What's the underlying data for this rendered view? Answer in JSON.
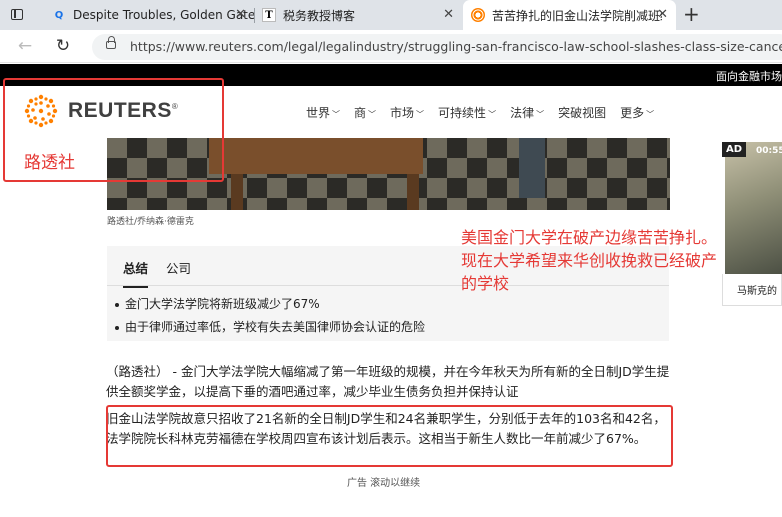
{
  "browser": {
    "tabs": [
      {
        "label": "Despite Troubles, Golden Gate U",
        "favicon": "search-icon"
      },
      {
        "label": "税务教授博客",
        "favicon": "taxprof-T-icon"
      },
      {
        "label": "苦苦挣扎的旧金山法学院削减班级",
        "favicon": "reuters-icon",
        "active": true
      }
    ],
    "url": "https://www.reuters.com/legal/legalindustry/struggling-san-francisco-law-school-slashes-class-size-cancels-tuition-2..."
  },
  "site": {
    "top_bar_text": "面向金融市场",
    "logo_word": "REUTERS",
    "logo_mark": "®",
    "nav": [
      "世界",
      "商",
      "市场",
      "可持续性",
      "法律",
      "突破视图",
      "更多"
    ]
  },
  "article": {
    "photo_caption": "路透社/乔纳森·德雷克",
    "summary_tabs": [
      "总结",
      "公司"
    ],
    "summary_bullets": [
      "金门大学法学院将新班级减少了67%",
      "由于律师通过率低，学校有失去美国律师协会认证的危险"
    ],
    "paragraph_1": "（路透社） - 金门大学法学院大幅缩减了第一年班级的规模，并在今年秋天为所有新的全日制JD学生提供全额奖学金，以提高下垂的酒吧通过率，减少毕业生债务负担并保持认证",
    "paragraph_2": "旧金山法学院故意只招收了21名新的全日制JD学生和24名兼职学生，分别低于去年的103名和42名，法学院院长科林克劳福德在学校周四宣布该计划后表示。这相当于新生人数比一年前减少了67%。",
    "ad_notice": "广告 滚动以继续"
  },
  "sidebar_ad": {
    "badge": "AD",
    "time": "00:55",
    "title": "马斯克的"
  },
  "annotations": {
    "logo_label": "路透社",
    "note": "美国金门大学在破产边缘苦苦挣扎。\n现在大学希望来华创收挽救已经破产的学校",
    "color": "#e53935"
  },
  "colors": {
    "reuters_orange": "#ff8000",
    "top_bar": "#000000"
  }
}
